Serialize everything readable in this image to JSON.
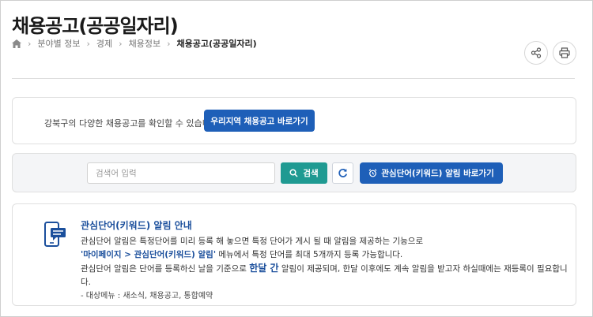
{
  "header": {
    "title": "채용공고(공공일자리)",
    "breadcrumb": {
      "home_icon": "home-icon",
      "items": [
        "분야별 정보",
        "경제",
        "채용정보"
      ],
      "current": "채용공고(공공일자리)"
    },
    "actions": {
      "share_icon": "share-icon",
      "print_icon": "print-icon"
    }
  },
  "region": {
    "text": "강북구의 다양한 채용공고를 확인할 수 있습니다.",
    "button": "우리지역 채용공고 바로가기"
  },
  "search": {
    "placeholder": "검색어 입력",
    "value": "",
    "search_button": "검색",
    "refresh_icon": "refresh-icon",
    "alert_button": "관심단어(키워드) 알림 바로가기"
  },
  "notice": {
    "icon": "mobile-alert-icon",
    "title": "관심단어(키워드) 알림 안내",
    "line1": "관심단어 알림은 특정단어를 미리 등록 해 놓으면 특정 단어가 게시 될 때 알림을 제공하는 기능으로",
    "line2_highlight": "'마이페이지 > 관심단어(키워드) 알림'",
    "line2_rest": " 메뉴에서 특정 단어를 최대 5개까지 등록 가능합니다.",
    "line3_pre": "관심단어 알림은 단어를 등록하신 날을 기준으로 ",
    "line3_highlight": "한달 간",
    "line3_post": " 알림이 제공되며, 한달 이후에도 계속 알림을 받고자 하실때에는 재등록이 필요합니다.",
    "line4": "- 대상메뉴 : 새소식, 채용공고, 통합예약"
  },
  "colors": {
    "primary": "#1e5fb8",
    "teal": "#1f9a92",
    "highlight": "#1b4f9c"
  }
}
